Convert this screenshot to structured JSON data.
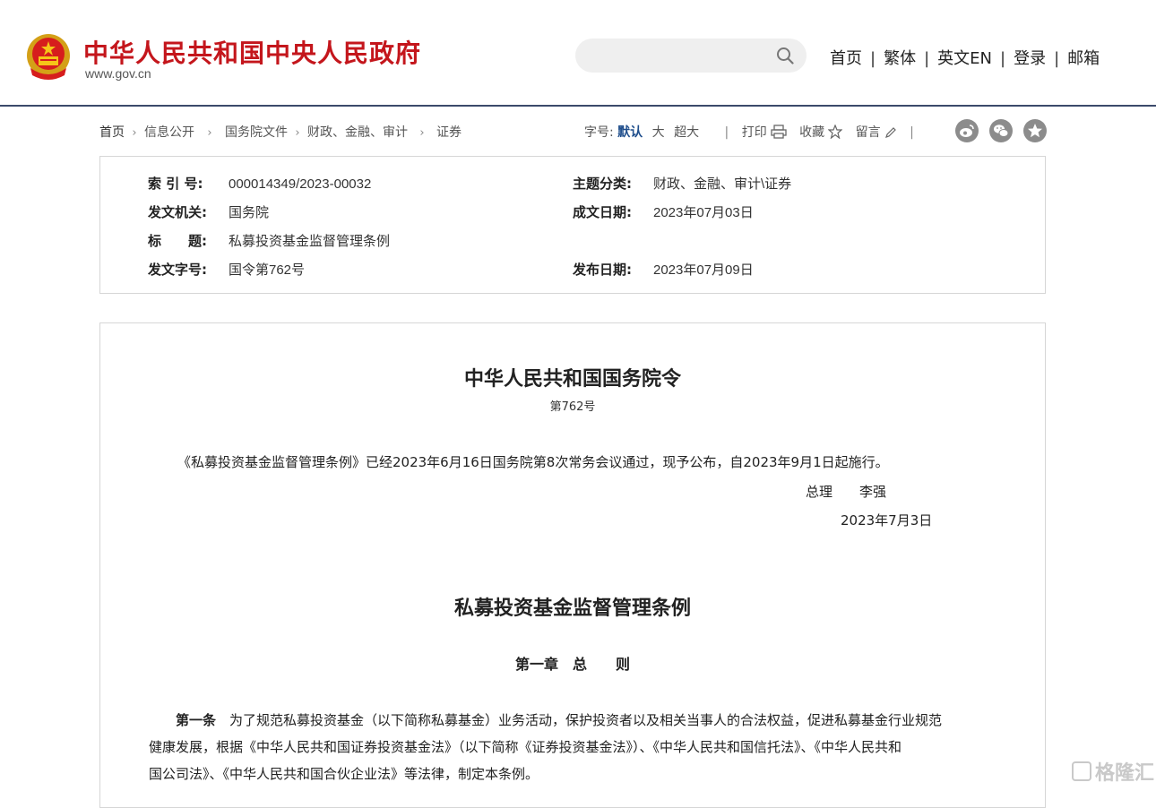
{
  "colors": {
    "brand_red": "#c4161c",
    "nav_blue": "#1f4e8c",
    "header_line": "#3b4a6b"
  },
  "header": {
    "site_title": "中华人民共和国中央人民政府",
    "domain": "www.gov.cn",
    "search": {
      "placeholder": "",
      "icon": "search-icon"
    },
    "nav": [
      "首页",
      "繁体",
      "英文EN",
      "登录",
      "邮箱"
    ]
  },
  "breadcrumb": [
    "首页",
    "信息公开",
    "国务院文件",
    "财政、金融、审计",
    "证券"
  ],
  "tools": {
    "font_label": "字号:",
    "font_sizes": [
      "默认",
      "大",
      "超大"
    ],
    "selected_font": "默认",
    "print": "打印",
    "favorite": "收藏",
    "comment": "留言",
    "share_icons": [
      "weibo-icon",
      "wechat-icon",
      "star-icon"
    ]
  },
  "meta": {
    "index_label": "索 引 号:",
    "index_value": "000014349/2023-00032",
    "topic_label": "主题分类:",
    "topic_value": "财政、金融、审计\\证券",
    "issuer_label": "发文机关:",
    "issuer_value": "国务院",
    "written_label": "成文日期:",
    "written_value": "2023年07月03日",
    "title_label": "标　　题:",
    "title_value": "私募投资基金监督管理条例",
    "docno_label": "发文字号:",
    "docno_value": "国令第762号",
    "publish_label": "发布日期:",
    "publish_value": "2023年07月09日"
  },
  "content": {
    "order_title": "中华人民共和国国务院令",
    "order_number": "第762号",
    "promulgation": "《私募投资基金监督管理条例》已经2023年6月16日国务院第8次常务会议通过，现予公布，自2023年9月1日起施行。",
    "signer": "总理　　李强",
    "sign_date": "2023年7月3日",
    "law_title": "私募投资基金监督管理条例",
    "chapter": "第一章　总　　则",
    "article1_label": "第一条",
    "article1_line1": "　为了规范私募投资基金（以下简称私募基金）业务活动，保护投资者以及相关当事人的合法权益，促进私募基金行业规范",
    "article1_line2": "健康发展，根据《中华人民共和国证券投资基金法》（以下简称《证券投资基金法》）、《中华人民共和国信托法》、《中华人民共和",
    "article1_line3": "国公司法》、《中华人民共和国合伙企业法》等法律，制定本条例。"
  },
  "watermark": "格隆汇"
}
